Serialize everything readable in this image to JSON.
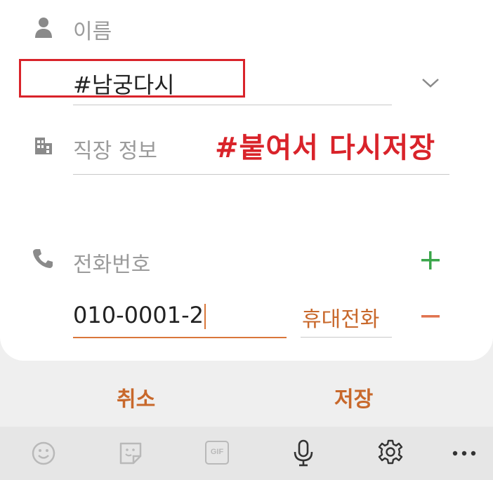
{
  "form": {
    "name_label": "이름",
    "name_value": "#남궁다시",
    "company_label": "직장 정보",
    "phone_label": "전화번호",
    "phone_value": "010-0001-2",
    "phone_type": "휴대전화"
  },
  "annotation": {
    "text": "#붙여서 다시저장",
    "color": "#d9232a"
  },
  "actions": {
    "cancel_label": "취소",
    "save_label": "저장"
  },
  "keyboard": {
    "icons": [
      "emoji-icon",
      "sticker-icon",
      "gif-icon",
      "microphone-icon",
      "settings-icon",
      "more-icon"
    ],
    "gif_label": "GIF"
  },
  "colors": {
    "accent": "#c8682b",
    "add_green": "#3aa64a",
    "remove_red": "#e0734f"
  }
}
